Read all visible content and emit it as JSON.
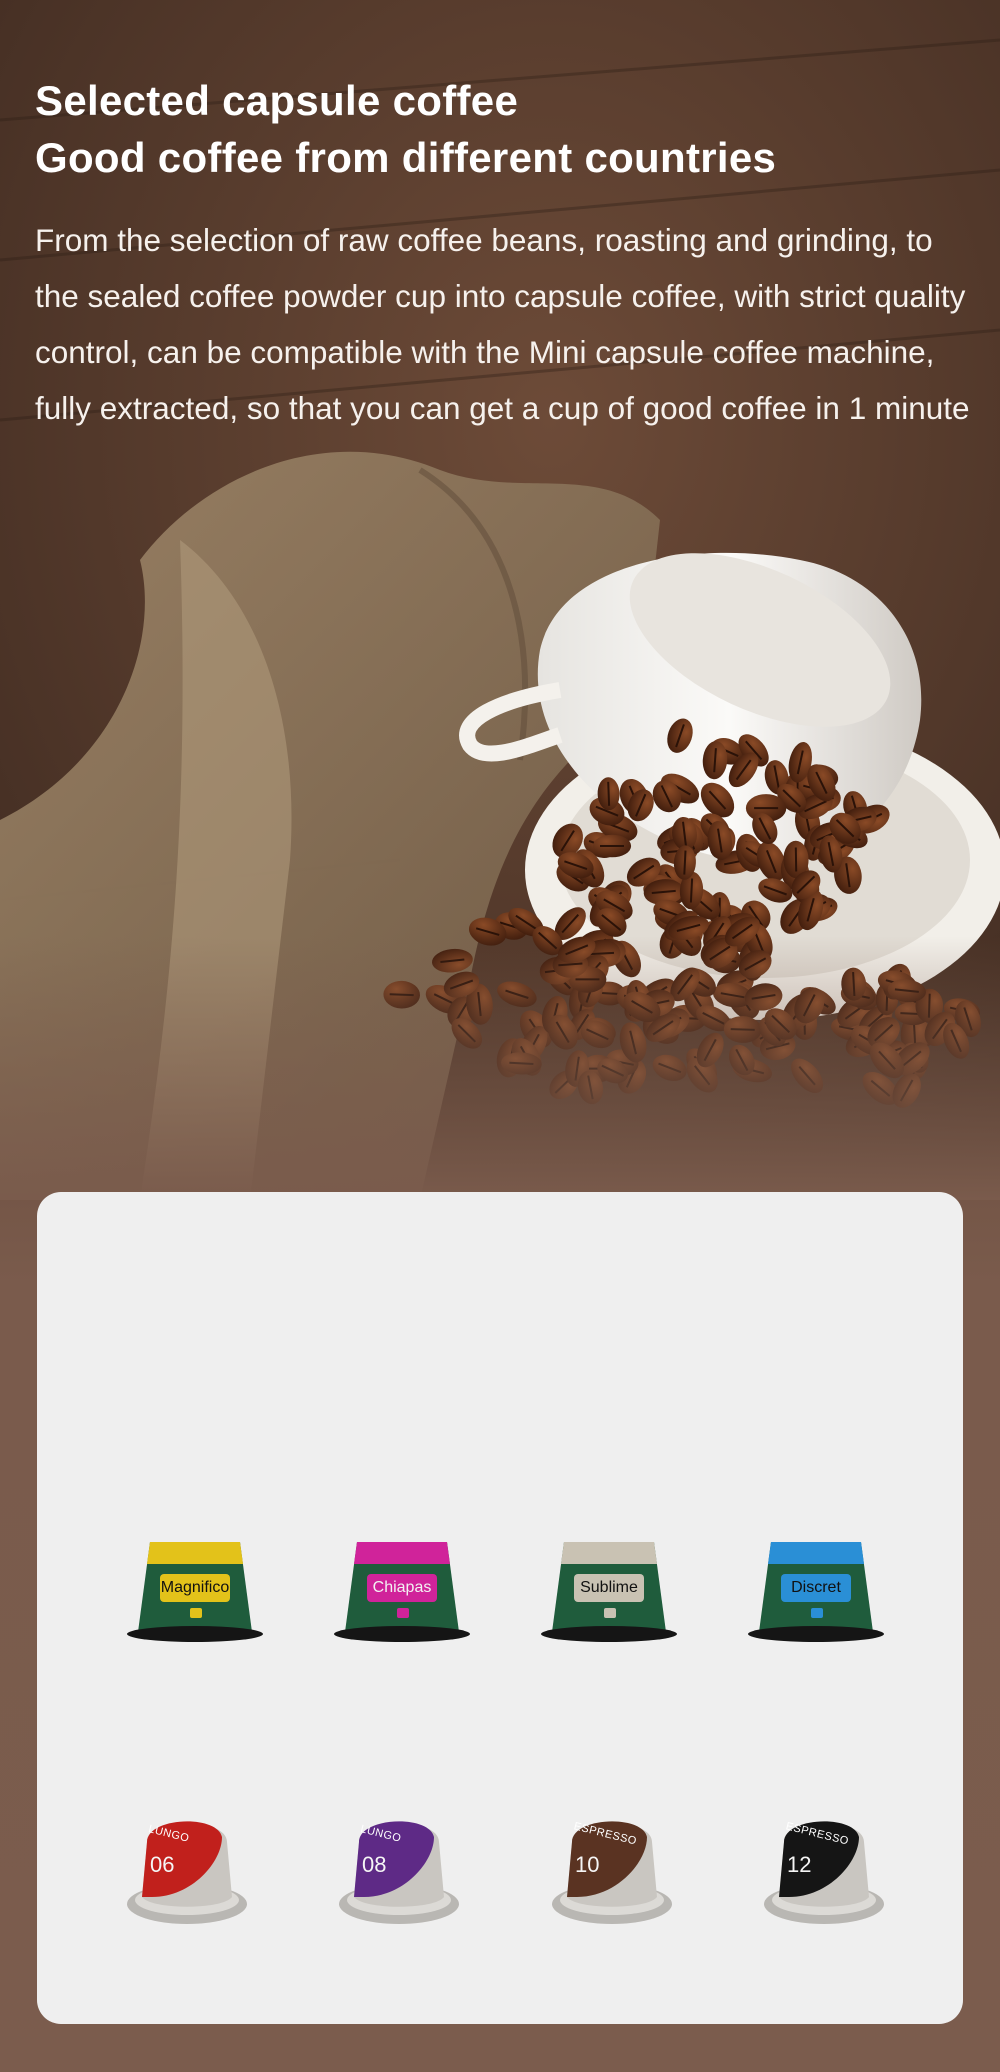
{
  "hero": {
    "headline_line1": "Selected capsule coffee",
    "headline_line2": "Good coffee from different countries",
    "description": "From the selection of raw coffee beans, roasting and grinding, to the sealed coffee powder cup into capsule coffee, with strict quality control, can be compatible with the Mini capsule coffee machine, fully extracted, so that you can get a cup of good coffee in 1 minute"
  },
  "capsules_row1": [
    {
      "label": "Magnifico",
      "band_color": "#e3c21a",
      "body_color": "#1f5c3c"
    },
    {
      "label": "Chiapas",
      "band_color": "#d0239a",
      "body_color": "#1f5c3c"
    },
    {
      "label": "Sublime",
      "band_color": "#c9c2b3",
      "body_color": "#1f5c3c"
    },
    {
      "label": "Discret",
      "band_color": "#2a8fd6",
      "body_color": "#1f5c3c"
    }
  ],
  "capsules_row2": [
    {
      "type": "LUNGO",
      "number": "06",
      "color": "#c1201c"
    },
    {
      "type": "LUNGO",
      "number": "08",
      "color": "#5e2a86"
    },
    {
      "type": "ESPRESSO",
      "number": "10",
      "color": "#5a3322"
    },
    {
      "type": "ESPRESSO",
      "number": "12",
      "color": "#151515"
    }
  ],
  "colors": {
    "page_background": "#7a5b4c",
    "panel_background": "#efefef",
    "headline_text": "#ffffff"
  }
}
